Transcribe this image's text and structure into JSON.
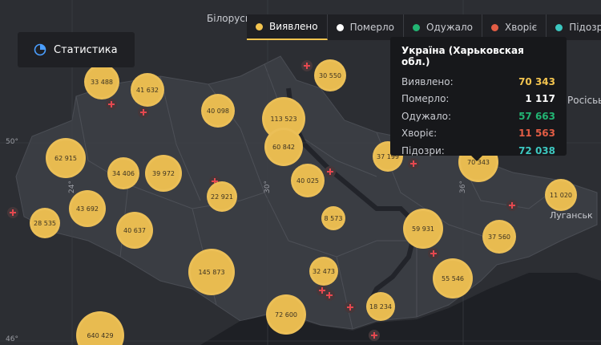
{
  "places": {
    "belarus": "Білорусь",
    "russia": "Росісьь",
    "luhansk": "Луганськ"
  },
  "grid_labels": {
    "lat50": "50°",
    "lat46": "46°",
    "lon24": "24°",
    "lon30": "30°",
    "lon36": "36°"
  },
  "stat_button": {
    "icon": "clock-pie-icon",
    "label": "Статистика"
  },
  "tabs": [
    {
      "label": "Виявлено",
      "color": "#f3c44f",
      "active": true
    },
    {
      "label": "Померло",
      "color": "#ffffff",
      "active": false
    },
    {
      "label": "Одужало",
      "color": "#22b573",
      "active": false
    },
    {
      "label": "Хворіє",
      "color": "#e35d45",
      "active": false
    },
    {
      "label": "Підозри",
      "color": "#3cc7c0",
      "active": false
    }
  ],
  "tooltip": {
    "title": "Україна (Харьковская обл.)",
    "rows": [
      {
        "label": "Виявлено:",
        "value": "70 343",
        "color": "#f3c44f"
      },
      {
        "label": "Померло:",
        "value": "1 117",
        "color": "#ffffff"
      },
      {
        "label": "Одужало:",
        "value": "57 663",
        "color": "#22b573"
      },
      {
        "label": "Хворіє:",
        "value": "11 563",
        "color": "#e35d45"
      },
      {
        "label": "Підозри:",
        "value": "72 038",
        "color": "#3cc7c0"
      }
    ]
  },
  "bubbles": [
    {
      "value": "33 488"
    },
    {
      "value": "41 632"
    },
    {
      "value": "30 550"
    },
    {
      "value": "40 098"
    },
    {
      "value": "113 523"
    },
    {
      "value": "60 842"
    },
    {
      "value": "62 915"
    },
    {
      "value": "34 406"
    },
    {
      "value": "39 972"
    },
    {
      "value": "22 921"
    },
    {
      "value": "40 025"
    },
    {
      "value": "37 199"
    },
    {
      "value": "70 343"
    },
    {
      "value": "11 020"
    },
    {
      "value": "28 535"
    },
    {
      "value": "43 692"
    },
    {
      "value": "40 637"
    },
    {
      "value": "8 573"
    },
    {
      "value": "59 931"
    },
    {
      "value": "37 560"
    },
    {
      "value": "145 873"
    },
    {
      "value": "32 473"
    },
    {
      "value": "55 546"
    },
    {
      "value": "72 600"
    },
    {
      "value": "18 234"
    },
    {
      "value": "640 429"
    }
  ]
}
